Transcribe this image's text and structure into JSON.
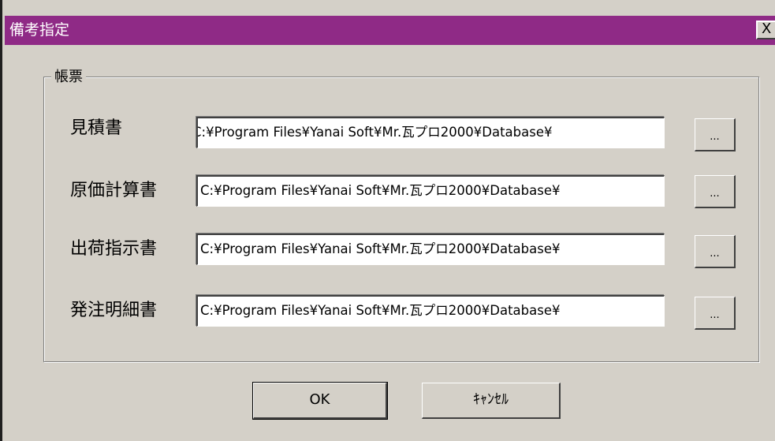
{
  "window": {
    "title": "備考指定",
    "close_label": "X",
    "colors": {
      "titlebar": "#8f2a86",
      "face": "#d4d0c8"
    }
  },
  "group": {
    "label": "帳票",
    "rows": [
      {
        "label": "見積書",
        "path": "C:¥Program Files¥Yanai Soft¥Mr.瓦プロ2000¥Database¥",
        "browse_label": "..."
      },
      {
        "label": "原価計算書",
        "path": "C:¥Program Files¥Yanai Soft¥Mr.瓦プロ2000¥Database¥",
        "browse_label": "..."
      },
      {
        "label": "出荷指示書",
        "path": "C:¥Program Files¥Yanai Soft¥Mr.瓦プロ2000¥Database¥",
        "browse_label": "..."
      },
      {
        "label": "発注明細書",
        "path": "C:¥Program Files¥Yanai Soft¥Mr.瓦プロ2000¥Database¥",
        "browse_label": "..."
      }
    ]
  },
  "buttons": {
    "ok": "OK",
    "cancel": "ｷｬﾝｾﾙ"
  }
}
